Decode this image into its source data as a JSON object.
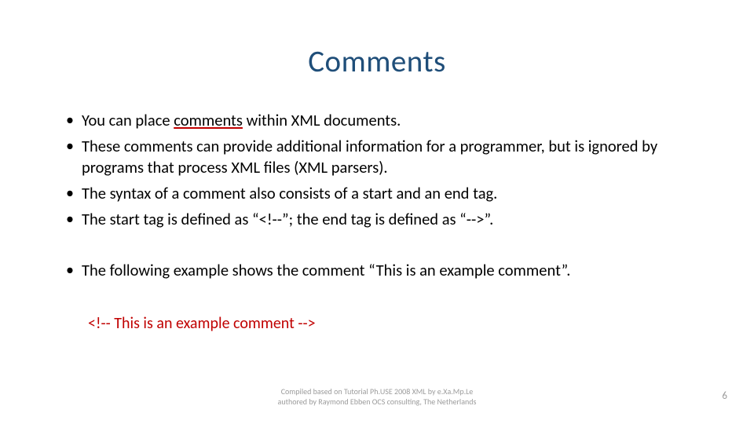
{
  "slide": {
    "title": "Comments",
    "bullets": [
      {
        "pre": " You can place ",
        "underlined": "comments",
        "post": " within XML documents."
      },
      {
        "text": "These comments can provide additional information for a programmer, but is ignored by programs that process XML files (XML parsers)."
      },
      {
        "text": "The syntax of a comment also consists of a start and an end tag."
      },
      {
        "text": "The start tag is defined as “<!--”; the end tag is defined as “-->”."
      },
      {
        "text": "The following example shows the comment “This is an example comment”."
      }
    ],
    "example": "<!-- This is an example comment -->",
    "footer": {
      "line1": "Compiled based on  Tutorial Ph.USE 2008 XML by e.Xa.Mp.Le",
      "line2": "authored by Raymond Ebben OCS consulting, The Netherlands"
    },
    "page_number": "6"
  }
}
